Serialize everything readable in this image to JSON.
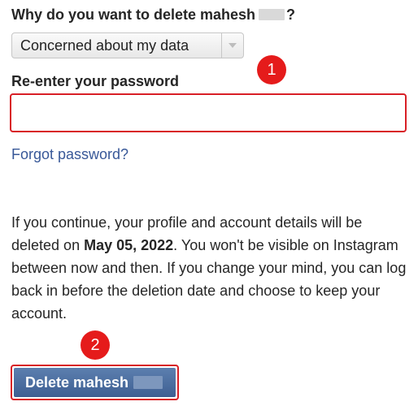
{
  "question": {
    "prefix": "Why do you want to delete mahesh",
    "suffix": "?"
  },
  "reason_select": {
    "selected": "Concerned about my data",
    "arrow_icon": "chevron-down-icon"
  },
  "password": {
    "label": "Re-enter your password",
    "value": "",
    "placeholder": ""
  },
  "forgot_link": "Forgot password?",
  "notice": {
    "part1": "If you continue, your profile and account details will be deleted on ",
    "date": "May 05, 2022",
    "part2": ". You won't be visible on Instagram between now and then. If you change your mind, you can log back in before the deletion date and choose to keep your account."
  },
  "delete_button": {
    "label": "Delete mahesh"
  },
  "markers": {
    "one": "1",
    "two": "2"
  },
  "colors": {
    "highlight": "#d81f26",
    "marker": "#e51b1b",
    "link": "#385898",
    "button": "#4a6ea1"
  }
}
